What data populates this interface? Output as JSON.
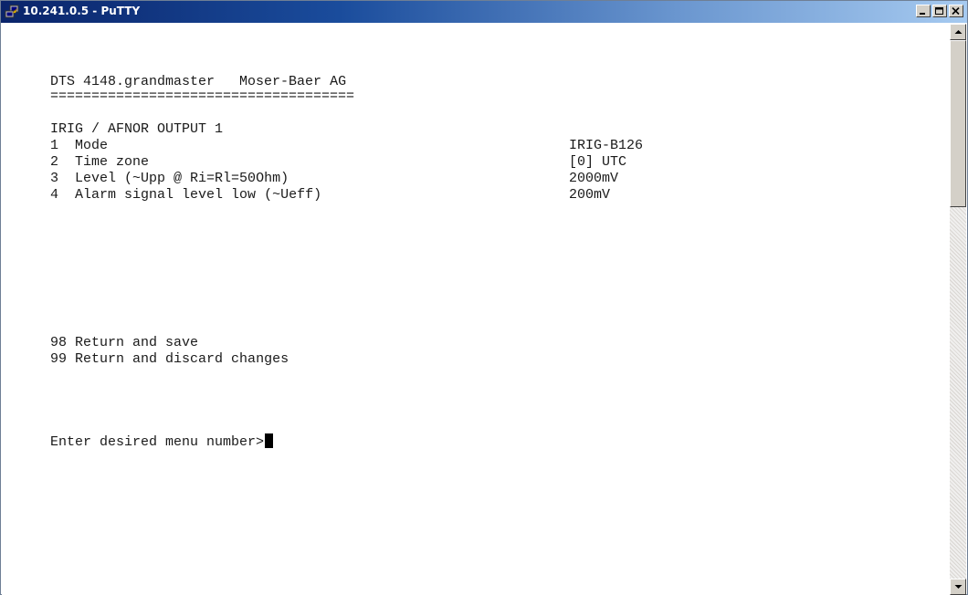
{
  "window": {
    "title": "10.241.0.5 - PuTTY",
    "icon": "putty-icon",
    "buttons": [
      "minimize-icon",
      "maximize-icon",
      "close-icon"
    ]
  },
  "terminal": {
    "header_device": "DTS 4148.grandmaster",
    "header_company": "Moser-Baer AG",
    "separator": "=====================================",
    "section_title": "IRIG / AFNOR OUTPUT 1",
    "items": [
      {
        "number": "1",
        "label": "Mode",
        "value": "IRIG-B126"
      },
      {
        "number": "2",
        "label": "Time zone",
        "value": "[0] UTC"
      },
      {
        "number": "3",
        "label": "Level (~Upp @ Ri=Rl=50Ohm)",
        "value": "2000mV"
      },
      {
        "number": "4",
        "label": "Alarm signal level low (~Ueff)",
        "value": "200mV"
      }
    ],
    "actions": [
      {
        "number": "98",
        "label": "Return and save"
      },
      {
        "number": "99",
        "label": "Return and discard changes"
      }
    ],
    "prompt": "Enter desired menu number>"
  },
  "colors": {
    "titlebar_start": "#0a246a",
    "titlebar_end": "#a6caf0",
    "terminal_background": "#ffffff",
    "terminal_text": "#1a1a1a"
  }
}
